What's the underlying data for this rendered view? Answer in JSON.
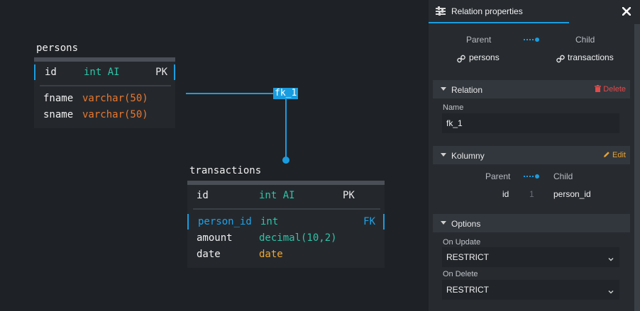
{
  "canvas": {
    "tables": {
      "persons": {
        "name": "persons",
        "columns": [
          {
            "name": "id",
            "type": "int AI",
            "key": "PK"
          },
          {
            "name": "fname",
            "type": "varchar(50)",
            "key": ""
          },
          {
            "name": "sname",
            "type": "varchar(50)",
            "key": ""
          }
        ]
      },
      "transactions": {
        "name": "transactions",
        "columns": [
          {
            "name": "id",
            "type": "int AI",
            "key": "PK"
          },
          {
            "name": "person_id",
            "type": "int",
            "key": "FK"
          },
          {
            "name": "amount",
            "type": "decimal(10,2)",
            "key": ""
          },
          {
            "name": "date",
            "type": "date",
            "key": ""
          }
        ]
      }
    },
    "relation_label": "fk_1"
  },
  "panel": {
    "title": "Relation properties",
    "icons": {
      "title": "sliders-icon",
      "close": "close-icon",
      "link": "link-icon",
      "trash": "trash-icon",
      "pencil": "pencil-icon",
      "caret": "caret-down-icon",
      "chevron": "chevron-down-icon"
    },
    "parent_label": "Parent",
    "child_label": "Child",
    "parent_table": "persons",
    "child_table": "transactions",
    "relation_section": {
      "title": "Relation",
      "action": "Delete"
    },
    "name_field": {
      "label": "Name",
      "value": "fk_1"
    },
    "columns_section": {
      "title": "Kolumny",
      "action": "Edit",
      "parent_label": "Parent",
      "child_label": "Child",
      "mappings": [
        {
          "parent": "id",
          "index": "1",
          "child": "person_id"
        }
      ]
    },
    "options_section": {
      "title": "Options",
      "on_update": {
        "label": "On Update",
        "value": "RESTRICT"
      },
      "on_delete": {
        "label": "On Delete",
        "value": "RESTRICT"
      }
    }
  },
  "colors": {
    "accent": "#1a9de0",
    "type_int": "#2ec4a6",
    "type_varchar": "#e8782f",
    "type_date": "#f0a830",
    "delete": "#e04a4a",
    "edit": "#e8a030"
  }
}
